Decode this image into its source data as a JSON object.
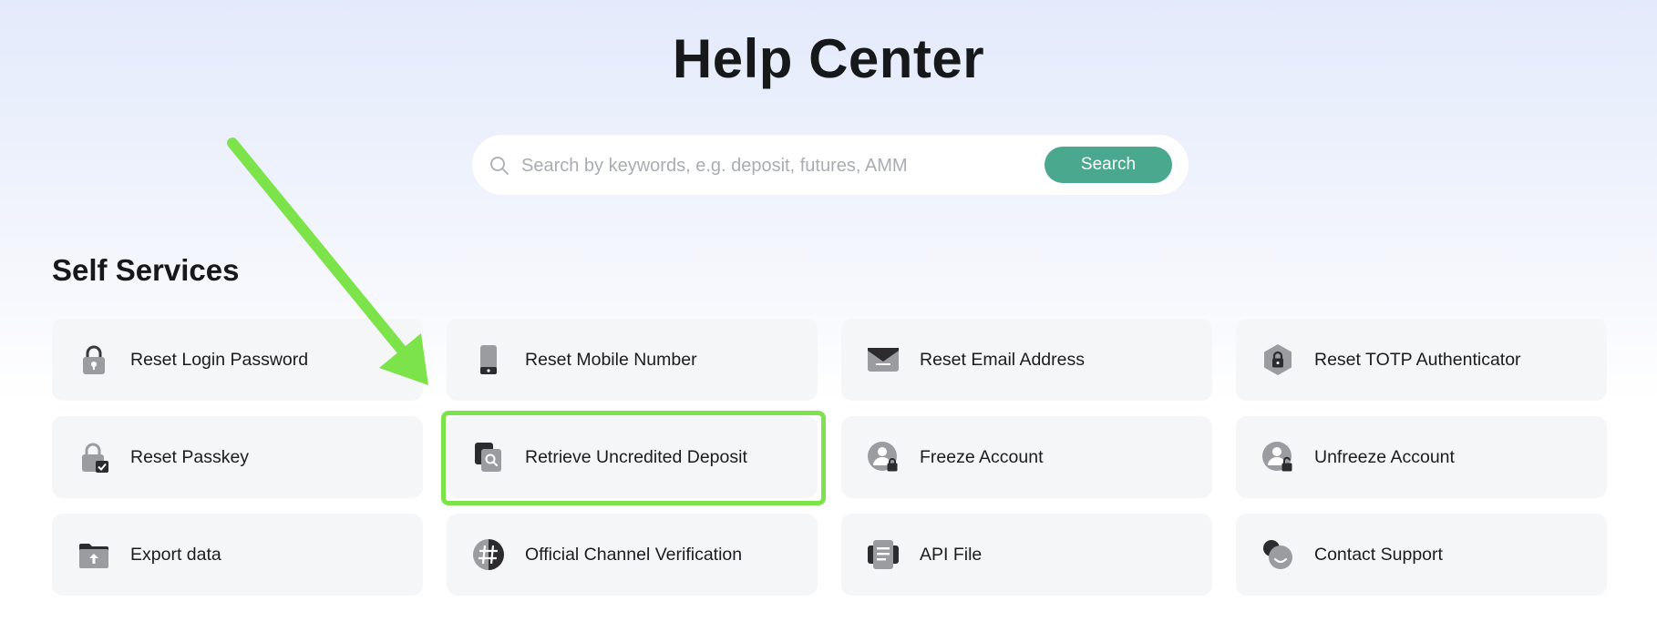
{
  "page": {
    "title": "Help Center"
  },
  "search": {
    "placeholder": "Search by keywords, e.g. deposit, futures, AMM",
    "value": "",
    "button_label": "Search",
    "button_color": "#4aa88f"
  },
  "self_services": {
    "title": "Self Services",
    "items": [
      {
        "label": "Reset Login Password",
        "icon": "padlock-icon"
      },
      {
        "label": "Reset Mobile Number",
        "icon": "mobile-phone-icon"
      },
      {
        "label": "Reset Email Address",
        "icon": "envelope-icon"
      },
      {
        "label": "Reset TOTP Authenticator",
        "icon": "hexagon-lock-icon"
      },
      {
        "label": "Reset Passkey",
        "icon": "lock-check-icon"
      },
      {
        "label": "Retrieve Uncredited Deposit",
        "icon": "document-search-icon"
      },
      {
        "label": "Freeze Account",
        "icon": "user-lock-icon"
      },
      {
        "label": "Unfreeze Account",
        "icon": "user-unlock-icon"
      },
      {
        "label": "Export data",
        "icon": "folder-upload-icon"
      },
      {
        "label": "Official Channel Verification",
        "icon": "hash-badge-icon"
      },
      {
        "label": "API File",
        "icon": "file-lines-icon"
      },
      {
        "label": "Contact Support",
        "icon": "chat-bubble-icon"
      }
    ]
  },
  "annotation": {
    "highlighted_item": "Retrieve Uncredited Deposit",
    "highlight_color": "#7de34a",
    "arrow_color": "#7de34a"
  }
}
